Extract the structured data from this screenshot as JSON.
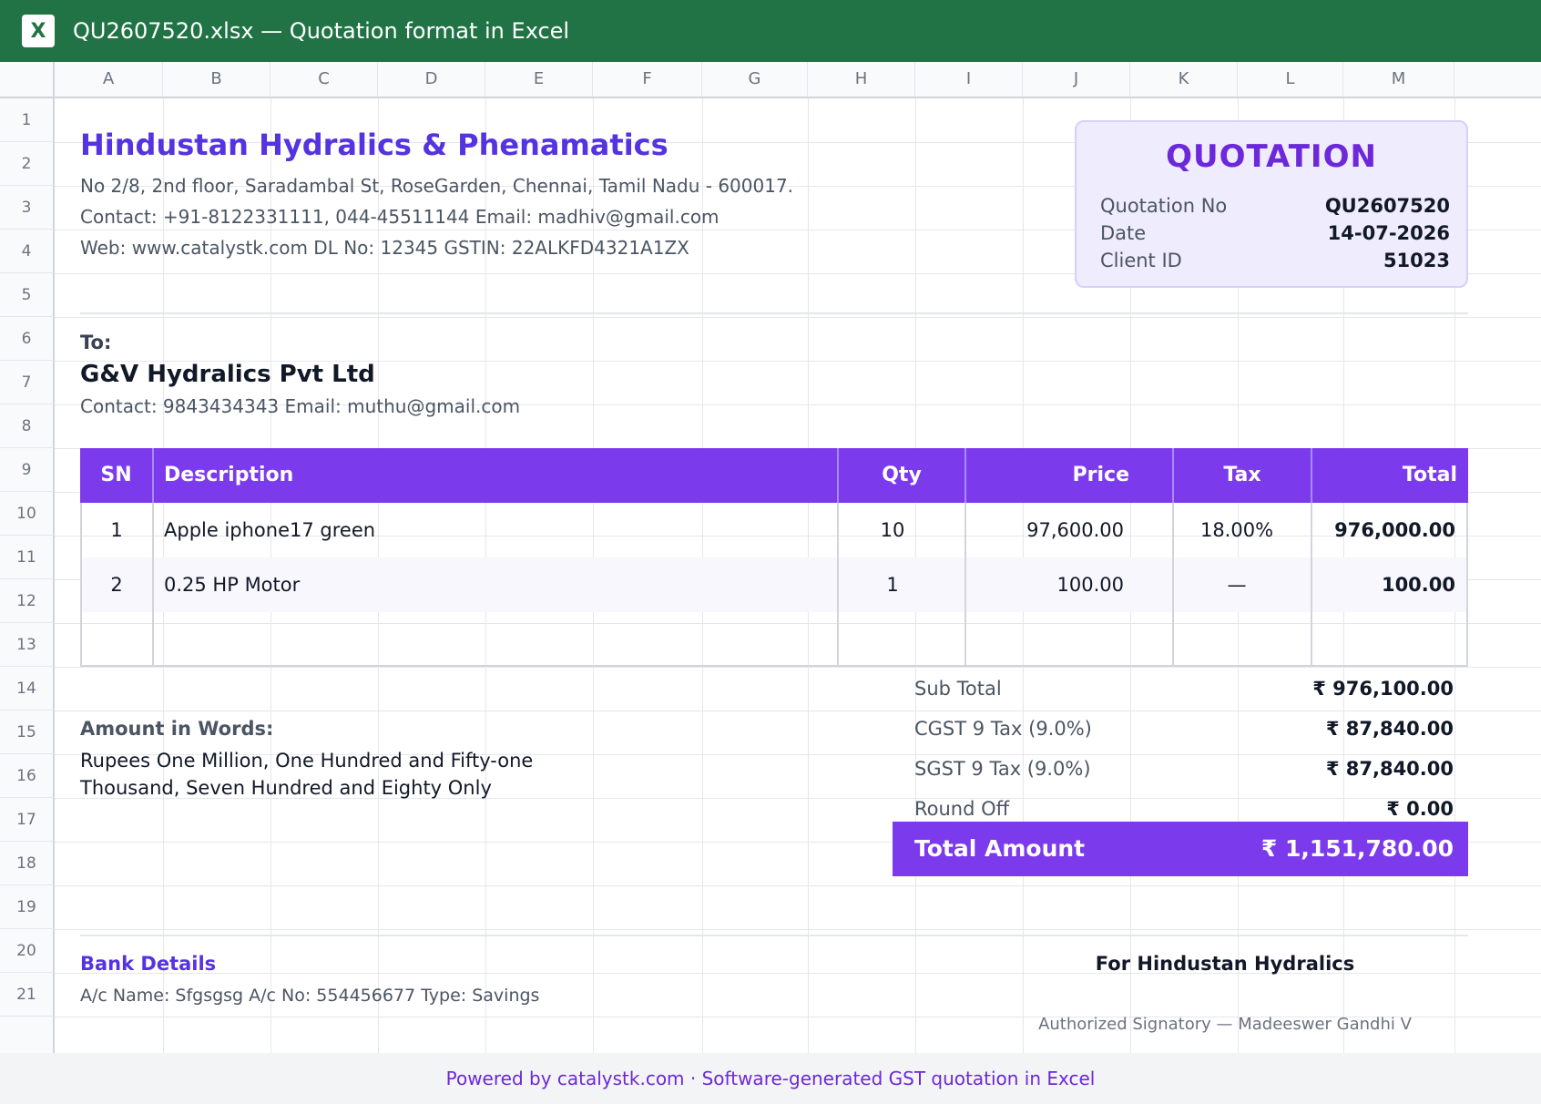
{
  "window": {
    "app_icon_letter": "X",
    "title": "QU2607520.xlsx — Quotation format in Excel"
  },
  "grid": {
    "columns": [
      "A",
      "B",
      "C",
      "D",
      "E",
      "F",
      "G",
      "H",
      "I",
      "J",
      "K",
      "L",
      "M"
    ],
    "rows": [
      "1",
      "2",
      "3",
      "4",
      "5",
      "6",
      "7",
      "8",
      "9",
      "10",
      "11",
      "12",
      "13",
      "14",
      "15",
      "16",
      "17",
      "18",
      "19",
      "20",
      "21"
    ]
  },
  "company": {
    "name": "Hindustan Hydralics & Phenamatics",
    "address": "No 2/8, 2nd floor, Saradambal St, RoseGarden, Chennai, Tamil Nadu - 600017.",
    "contact": "Contact: +91-8122331111, 044-45511144 Email: madhiv@gmail.com",
    "web": "Web: www.catalystk.com DL No: 12345 GSTIN: 22ALKFD4321A1ZX"
  },
  "quotation": {
    "heading": "QUOTATION",
    "no_label": "Quotation No",
    "no_value": "QU2607520",
    "date_label": "Date",
    "date_value": "14-07-2026",
    "client_label": "Client ID",
    "client_value": "51023"
  },
  "client": {
    "to_label": "To:",
    "name": "G&V Hydralics Pvt Ltd",
    "contact": "Contact: 9843434343 Email: muthu@gmail.com"
  },
  "items": {
    "headers": {
      "sn": "SN",
      "description": "Description",
      "qty": "Qty",
      "price": "Price",
      "tax": "Tax",
      "total": "Total"
    },
    "rows": [
      {
        "sn": "1",
        "description": "Apple iphone17 green",
        "qty": "10",
        "price": "97,600.00",
        "tax": "18.00%",
        "total": "976,000.00"
      },
      {
        "sn": "2",
        "description": "0.25 HP Motor",
        "qty": "1",
        "price": "100.00",
        "tax": "—",
        "total": "100.00"
      }
    ]
  },
  "totals": {
    "subtotal_label": "Sub Total",
    "subtotal_value": "₹ 976,100.00",
    "cgst_label": "CGST 9 Tax (9.0%)",
    "cgst_value": "₹ 87,840.00",
    "sgst_label": "SGST 9 Tax (9.0%)",
    "sgst_value": "₹ 87,840.00",
    "roundoff_label": "Round Off",
    "roundoff_value": "₹ 0.00",
    "grand_label": "Total Amount",
    "grand_value": "₹ 1,151,780.00"
  },
  "amount_words": {
    "label": "Amount in Words:",
    "text": "Rupees One Million, One Hundred and Fifty-one Thousand, Seven Hundred and Eighty Only"
  },
  "bank": {
    "label": "Bank Details",
    "text": "A/c Name: Sfgsgsg A/c No: 554456677 Type: Savings"
  },
  "signature": {
    "for_company": "For Hindustan Hydralics",
    "signatory": "Authorized Signatory — Madeeswer Gandhi V"
  },
  "footer": {
    "text": "Powered by catalystk.com · Software-generated GST quotation in Excel"
  },
  "colors": {
    "excel_green": "#217346",
    "accent_purple": "#7c3aed",
    "brand_indigo": "#5533e0"
  }
}
